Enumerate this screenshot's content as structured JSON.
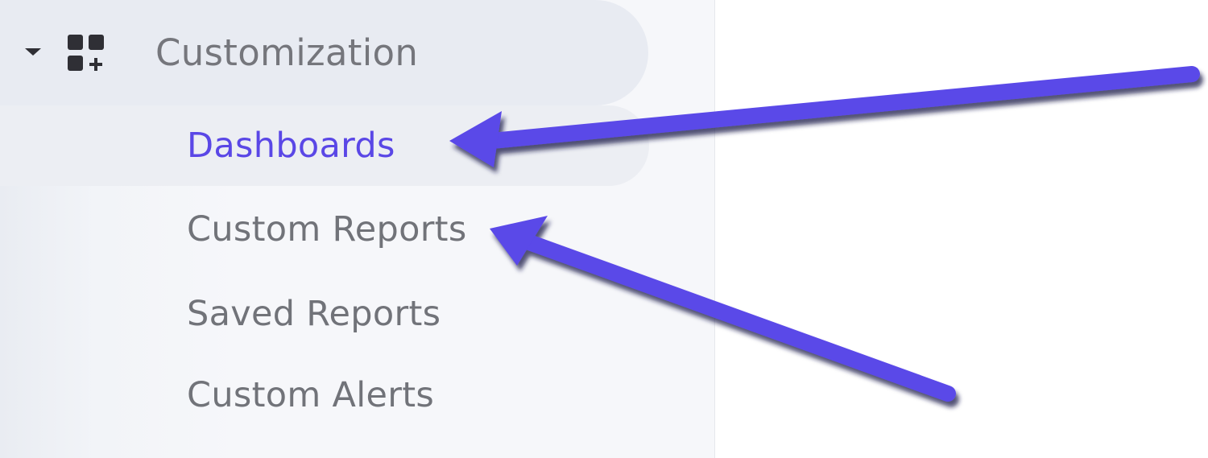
{
  "sidebar": {
    "group": {
      "label": "Customization",
      "toggle_icon": "caret-down-icon",
      "group_icon": "customize-grid-icon"
    },
    "items": [
      {
        "label": "Dashboards",
        "active": true
      },
      {
        "label": "Custom Reports",
        "active": false
      },
      {
        "label": "Saved Reports",
        "active": false
      },
      {
        "label": "Custom Alerts",
        "active": false
      }
    ]
  },
  "annotations": {
    "arrow_color": "#5a48e8",
    "arrow_shadow_color": "#1e1b4a",
    "active_text_color": "#5a47e6",
    "inactive_text_color": "#717379"
  }
}
